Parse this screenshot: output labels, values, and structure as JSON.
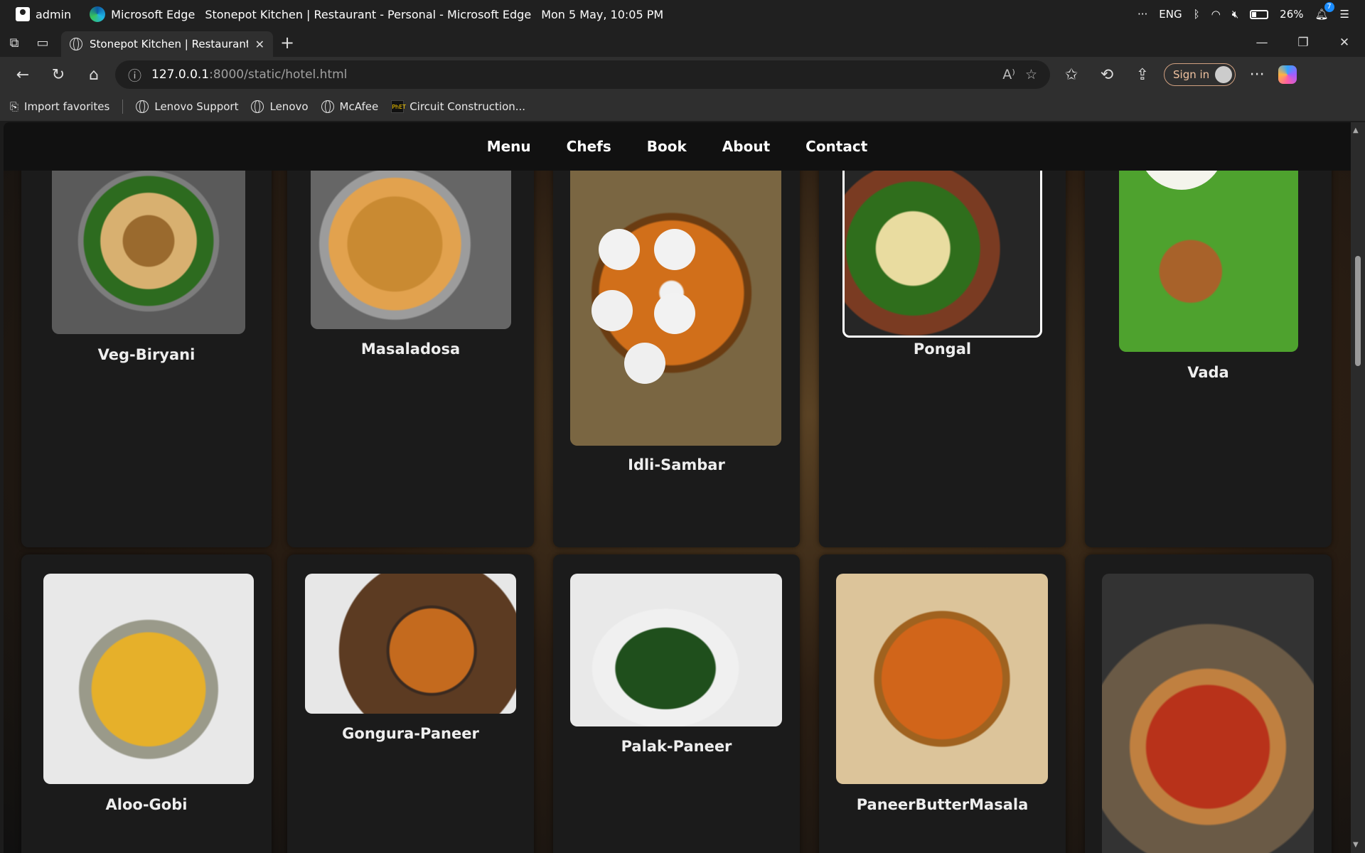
{
  "os_bar": {
    "user": "admin",
    "app": "Microsoft Edge",
    "window_title": "Stonepot Kitchen | Restaurant - Personal - Microsoft Edge",
    "datetime": "Mon 5 May, 10:05 PM",
    "language": "ENG",
    "battery": "26%",
    "notifications": "7"
  },
  "browser": {
    "tab_title": "Stonepot Kitchen | Restaurant",
    "url_host": "127.0.0.1",
    "url_path": ":8000/static/hotel.html",
    "signin_label": "Sign in",
    "favorites": [
      "Import favorites",
      "Lenovo Support",
      "Lenovo",
      "McAfee",
      "Circuit Construction..."
    ]
  },
  "site": {
    "nav": [
      "Menu",
      "Chefs",
      "Book",
      "About",
      "Contact"
    ],
    "dishes": [
      "Veg-Biryani",
      "Masaladosa",
      "Idli-Sambar",
      "Pongal",
      "Vada",
      "Aloo-Gobi",
      "Gongura-Paneer",
      "Palak-Paneer",
      "PaneerButterMasala"
    ]
  },
  "colors": {
    "page_bg": "#1b1b1b",
    "navbar_bg": "#111111",
    "signin_border": "#d0a080"
  }
}
